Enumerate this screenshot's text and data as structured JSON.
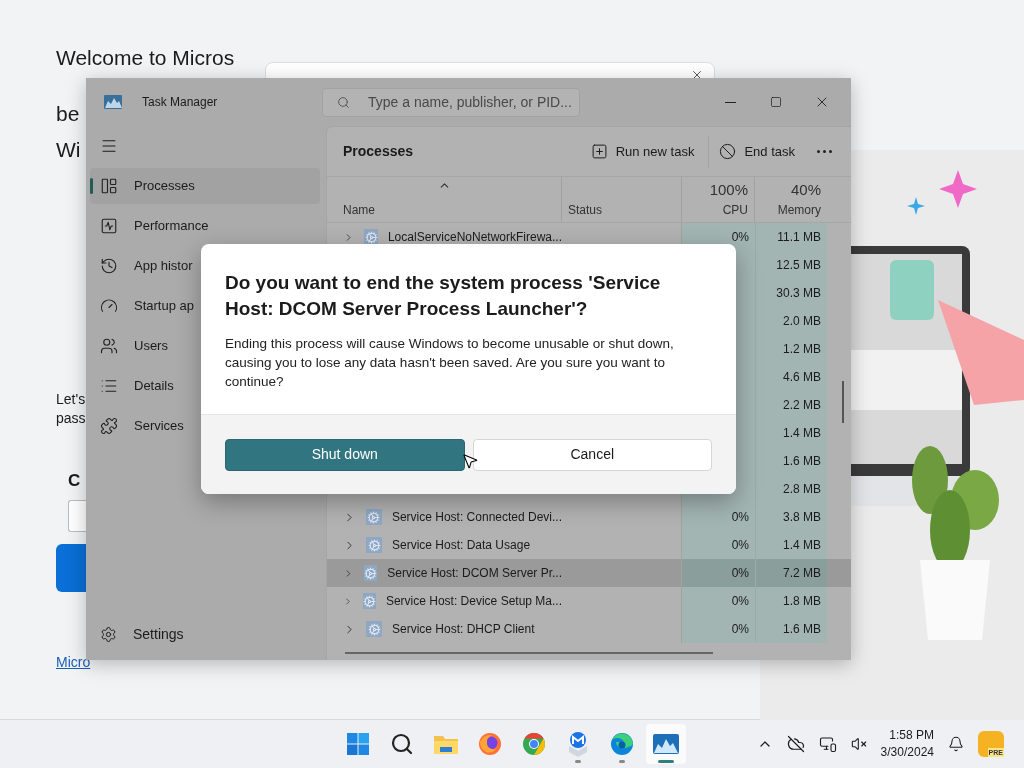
{
  "background_page": {
    "heading_lines": [
      "Welcome to Micros",
      "be",
      "Wi"
    ],
    "body_lines": [
      "Let's",
      "pass"
    ],
    "subheading": "C",
    "link": "Micro"
  },
  "task_manager": {
    "title": "Task Manager",
    "search": {
      "placeholder": "Type a name, publisher, or PID..."
    },
    "nav": [
      {
        "label": "Processes",
        "kind": "processes",
        "selected": true
      },
      {
        "label": "Performance",
        "kind": "performance",
        "selected": false
      },
      {
        "label": "App histor",
        "kind": "history",
        "selected": false
      },
      {
        "label": "Startup ap",
        "kind": "startup",
        "selected": false
      },
      {
        "label": "Users",
        "kind": "users",
        "selected": false
      },
      {
        "label": "Details",
        "kind": "details",
        "selected": false
      },
      {
        "label": "Services",
        "kind": "services",
        "selected": false
      }
    ],
    "settings": "Settings",
    "page_title": "Processes",
    "actions": [
      {
        "label": "Run new task",
        "kind": "run"
      },
      {
        "label": "End task",
        "kind": "end"
      }
    ],
    "columns": {
      "name": "Name",
      "status": "Status",
      "cpu_total": "100%",
      "cpu": "CPU",
      "memory_total": "40%",
      "memory": "Memory"
    },
    "rows": [
      {
        "name": "LocalServiceNoNetworkFirewa...",
        "cpu": "0%",
        "memory": "11.1 MB",
        "selected": false
      },
      {
        "memory": "12.5 MB",
        "selected": false
      },
      {
        "memory": "30.3 MB",
        "selected": false
      },
      {
        "memory": "2.0 MB",
        "selected": false
      },
      {
        "memory": "1.2 MB",
        "selected": false
      },
      {
        "memory": "4.6 MB",
        "selected": false
      },
      {
        "memory": "2.2 MB",
        "selected": false
      },
      {
        "memory": "1.4 MB",
        "selected": false
      },
      {
        "memory": "1.6 MB",
        "selected": false
      },
      {
        "memory": "2.8 MB",
        "selected": false
      },
      {
        "name": "Service Host: Connected Devi...",
        "cpu": "0%",
        "memory": "3.8 MB",
        "selected": false
      },
      {
        "name": "Service Host: Data Usage",
        "cpu": "0%",
        "memory": "1.4 MB",
        "selected": false
      },
      {
        "name": "Service Host: DCOM Server Pr...",
        "cpu": "0%",
        "memory": "7.2 MB",
        "selected": true
      },
      {
        "name": "Service Host: Device Setup Ma...",
        "cpu": "0%",
        "memory": "1.8 MB",
        "selected": false
      },
      {
        "name": "Service Host: DHCP Client",
        "cpu": "0%",
        "memory": "1.6 MB",
        "selected": false
      }
    ]
  },
  "dialog": {
    "title": "Do you want to end the system process 'Service Host: DCOM Server Process Launcher'?",
    "message": "Ending this process will cause Windows to become unusable or shut down, causing you to lose any data hasn't been saved. Are you sure you want to continue?",
    "buttons": [
      {
        "label": "Shut down",
        "kind": "primary"
      },
      {
        "label": "Cancel",
        "kind": "secondary"
      }
    ]
  },
  "taskbar": {
    "apps": [
      {
        "kind": "start",
        "running": false,
        "active": false
      },
      {
        "kind": "search",
        "running": false,
        "active": false
      },
      {
        "kind": "files",
        "running": false,
        "active": false
      },
      {
        "kind": "firefox",
        "running": false,
        "active": false
      },
      {
        "kind": "chrome",
        "running": false,
        "active": false
      },
      {
        "kind": "shield",
        "running": true,
        "active": false
      },
      {
        "kind": "edge",
        "running": true,
        "active": false
      },
      {
        "kind": "taskmanager",
        "running": true,
        "active": true
      }
    ],
    "time": "1:58 PM",
    "date": "3/30/2024",
    "badge": "PRE"
  }
}
